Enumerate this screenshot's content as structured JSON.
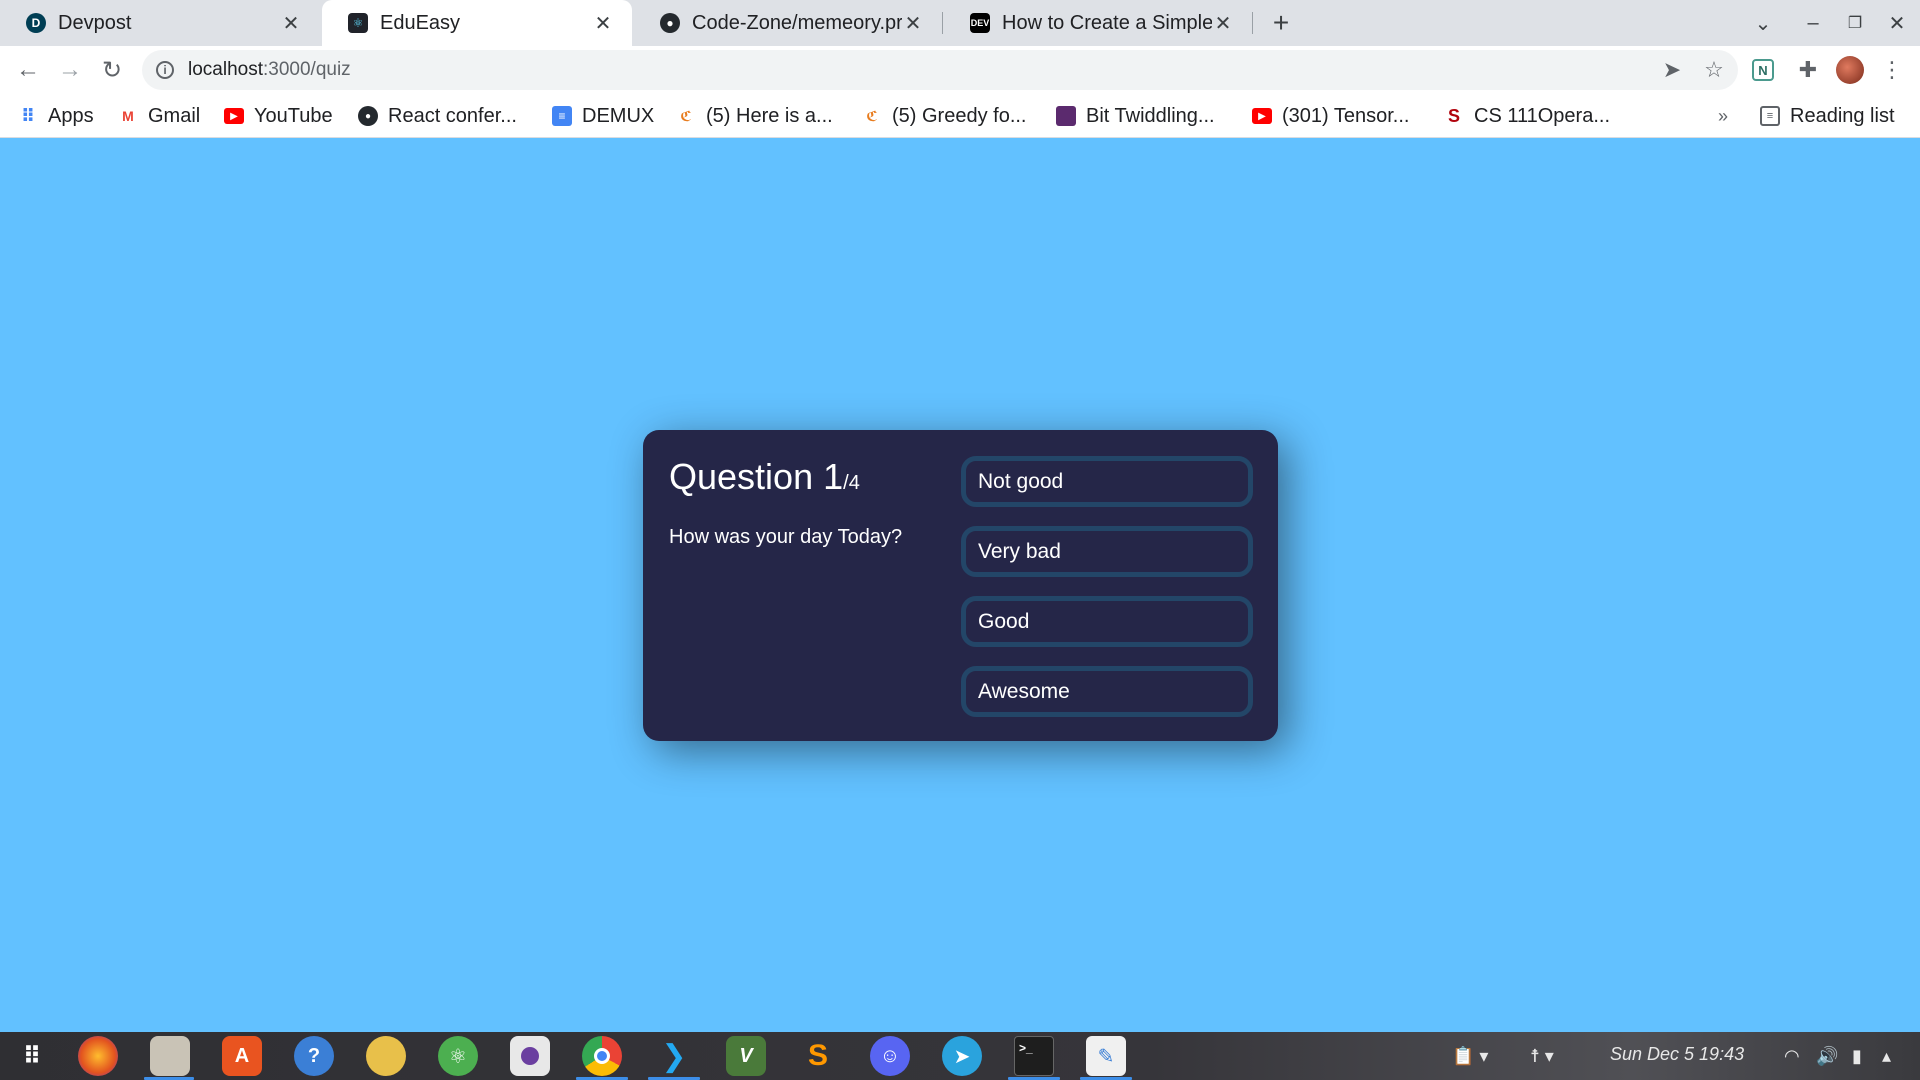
{
  "browser": {
    "tabs": [
      {
        "title": "Devpost",
        "active": false
      },
      {
        "title": "EduEasy",
        "active": true
      },
      {
        "title": "Code-Zone/memeory.pr",
        "active": false
      },
      {
        "title": "How to Create a Simple",
        "active": false
      }
    ],
    "new_tab": "+",
    "address": {
      "host": "localhost",
      "path": ":3000/quiz"
    },
    "bookmarks": [
      {
        "label": "Apps"
      },
      {
        "label": "Gmail"
      },
      {
        "label": "YouTube"
      },
      {
        "label": "React confer..."
      },
      {
        "label": "DEMUX"
      },
      {
        "label": "(5) Here is a..."
      },
      {
        "label": "(5) Greedy fo..."
      },
      {
        "label": "Bit Twiddling..."
      },
      {
        "label": "(301) Tensor..."
      },
      {
        "label": "CS 111Opera..."
      }
    ],
    "bookmarks_overflow": "»",
    "reading_list": "Reading list",
    "extension_badge": "N"
  },
  "quiz": {
    "question_label": "Question",
    "current": "1",
    "total": "/4",
    "question_text": "How was your day Today?",
    "answers": [
      {
        "label": "Not good"
      },
      {
        "label": "Very bad"
      },
      {
        "label": "Good"
      },
      {
        "label": "Awesome"
      }
    ]
  },
  "taskbar": {
    "clock": "Sun Dec 5  19:43"
  },
  "colors": {
    "page_background": "#62c1ff",
    "card_background": "#252648",
    "answer_border": "#234668"
  }
}
